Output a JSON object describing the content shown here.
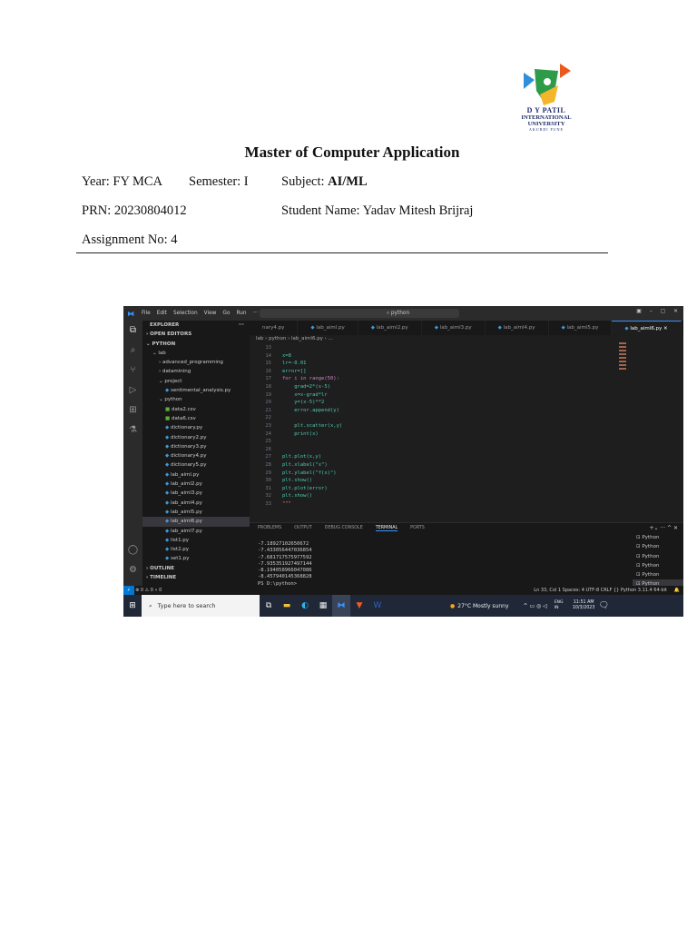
{
  "logo": {
    "line1": "D Y PATIL",
    "line2": "INTERNATIONAL",
    "line3": "UNIVERSITY",
    "line4": "AKURDI PUNE"
  },
  "title": "Master of Computer Application",
  "info": {
    "year": "Year: FY MCA",
    "semester": "Semester: I",
    "subject_label": "Subject: ",
    "subject": "AI/ML",
    "prn": "PRN: 20230804012",
    "student": "Student Name: Yadav Mitesh Brijraj",
    "assignment": "Assignment No: 4"
  },
  "vscode": {
    "menu": [
      "File",
      "Edit",
      "Selection",
      "View",
      "Go",
      "Run",
      "···"
    ],
    "search": "python",
    "explorer_title": "EXPLORER",
    "sidebar": [
      {
        "label": "› OPEN EDITORS",
        "kind": "hdr",
        "indent": 0
      },
      {
        "label": "⌄ PYTHON",
        "kind": "hdr",
        "indent": 0
      },
      {
        "label": "⌄ lab",
        "kind": "folder",
        "indent": 1
      },
      {
        "label": "› advanced_programming",
        "kind": "folder",
        "indent": 2
      },
      {
        "label": "› datamining",
        "kind": "folder",
        "indent": 2
      },
      {
        "label": "⌄ project",
        "kind": "folder",
        "indent": 2
      },
      {
        "label": "sentimental_analysis.py",
        "kind": "py",
        "indent": 3
      },
      {
        "label": "⌄ python",
        "kind": "folder",
        "indent": 2
      },
      {
        "label": "data2.csv",
        "kind": "csv",
        "indent": 3
      },
      {
        "label": "data6.csv",
        "kind": "csv",
        "indent": 3
      },
      {
        "label": "dictionary.py",
        "kind": "py",
        "indent": 3
      },
      {
        "label": "dictionary2.py",
        "kind": "py",
        "indent": 3
      },
      {
        "label": "dictionary3.py",
        "kind": "py",
        "indent": 3
      },
      {
        "label": "dictionary4.py",
        "kind": "py",
        "indent": 3
      },
      {
        "label": "dictionary5.py",
        "kind": "py",
        "indent": 3
      },
      {
        "label": "lab_aiml.py",
        "kind": "py",
        "indent": 3
      },
      {
        "label": "lab_aiml2.py",
        "kind": "py",
        "indent": 3
      },
      {
        "label": "lab_aiml3.py",
        "kind": "py",
        "indent": 3
      },
      {
        "label": "lab_aiml4.py",
        "kind": "py",
        "indent": 3
      },
      {
        "label": "lab_aiml5.py",
        "kind": "py",
        "indent": 3
      },
      {
        "label": "lab_aiml6.py",
        "kind": "py",
        "indent": 3,
        "selected": true
      },
      {
        "label": "lab_aiml7.py",
        "kind": "py",
        "indent": 3
      },
      {
        "label": "list1.py",
        "kind": "py",
        "indent": 3
      },
      {
        "label": "list2.py",
        "kind": "py",
        "indent": 3
      },
      {
        "label": "set1.py",
        "kind": "py",
        "indent": 3
      },
      {
        "label": "› OUTLINE",
        "kind": "hdr",
        "indent": 0
      },
      {
        "label": "› TIMELINE",
        "kind": "hdr",
        "indent": 0
      }
    ],
    "tabs": [
      "nary4.py",
      "lab_aiml.py",
      "lab_aiml2.py",
      "lab_aiml3.py",
      "lab_aiml4.py",
      "lab_aiml5.py",
      "lab_aiml6.py ✕"
    ],
    "breadcrumb": "lab › python › lab_aiml6.py › ...",
    "code": [
      {
        "n": "13",
        "t": ""
      },
      {
        "n": "14",
        "t": "x=8"
      },
      {
        "n": "15",
        "t": "lr=-0.01"
      },
      {
        "n": "16",
        "t": "error=[]"
      },
      {
        "n": "17",
        "t": "for i in range(50):"
      },
      {
        "n": "18",
        "t": "    grad=2*(x-5)"
      },
      {
        "n": "19",
        "t": "    x=x-grad*lr"
      },
      {
        "n": "20",
        "t": "    y=(x-5)**2"
      },
      {
        "n": "21",
        "t": "    error.append(y)"
      },
      {
        "n": "22",
        "t": ""
      },
      {
        "n": "23",
        "t": "    plt.scatter(x,y)"
      },
      {
        "n": "24",
        "t": "    print(x)"
      },
      {
        "n": "25",
        "t": ""
      },
      {
        "n": "26",
        "t": ""
      },
      {
        "n": "27",
        "t": "plt.plot(x,y)"
      },
      {
        "n": "28",
        "t": "plt.xlabel(\"x\")"
      },
      {
        "n": "29",
        "t": "plt.ylabel(\"f(x)\")"
      },
      {
        "n": "30",
        "t": "plt.show()"
      },
      {
        "n": "31",
        "t": "plt.plot(error)"
      },
      {
        "n": "32",
        "t": "plt.show()"
      },
      {
        "n": "33",
        "t": "\"\"\""
      }
    ],
    "panel_tabs": [
      "PROBLEMS",
      "OUTPUT",
      "DEBUG CONSOLE",
      "TERMINAL",
      "PORTS"
    ],
    "terminal": [
      "-7.18927102650672",
      "-7.433056447036854",
      "-7.681717575977592",
      "-7.935351927497144",
      "-8.194058966047086",
      "-8.457940145368828",
      "PS D:\\python>"
    ],
    "terminal_list": [
      "Python",
      "Python",
      "Python",
      "Python",
      "Python",
      "Python"
    ],
    "status_left": "⊗ 0 ⚠ 0   ⑂ 0",
    "status_right": "Ln 33, Col 1   Spaces: 4   UTF-8   CRLF   {} Python   3.11.4 64-bit",
    "taskbar": {
      "search": "Type here to search",
      "weather": "27°C  Mostly sunny",
      "lang": "ENG IN",
      "time": "11:51 AM",
      "date": "10/3/2023"
    }
  }
}
